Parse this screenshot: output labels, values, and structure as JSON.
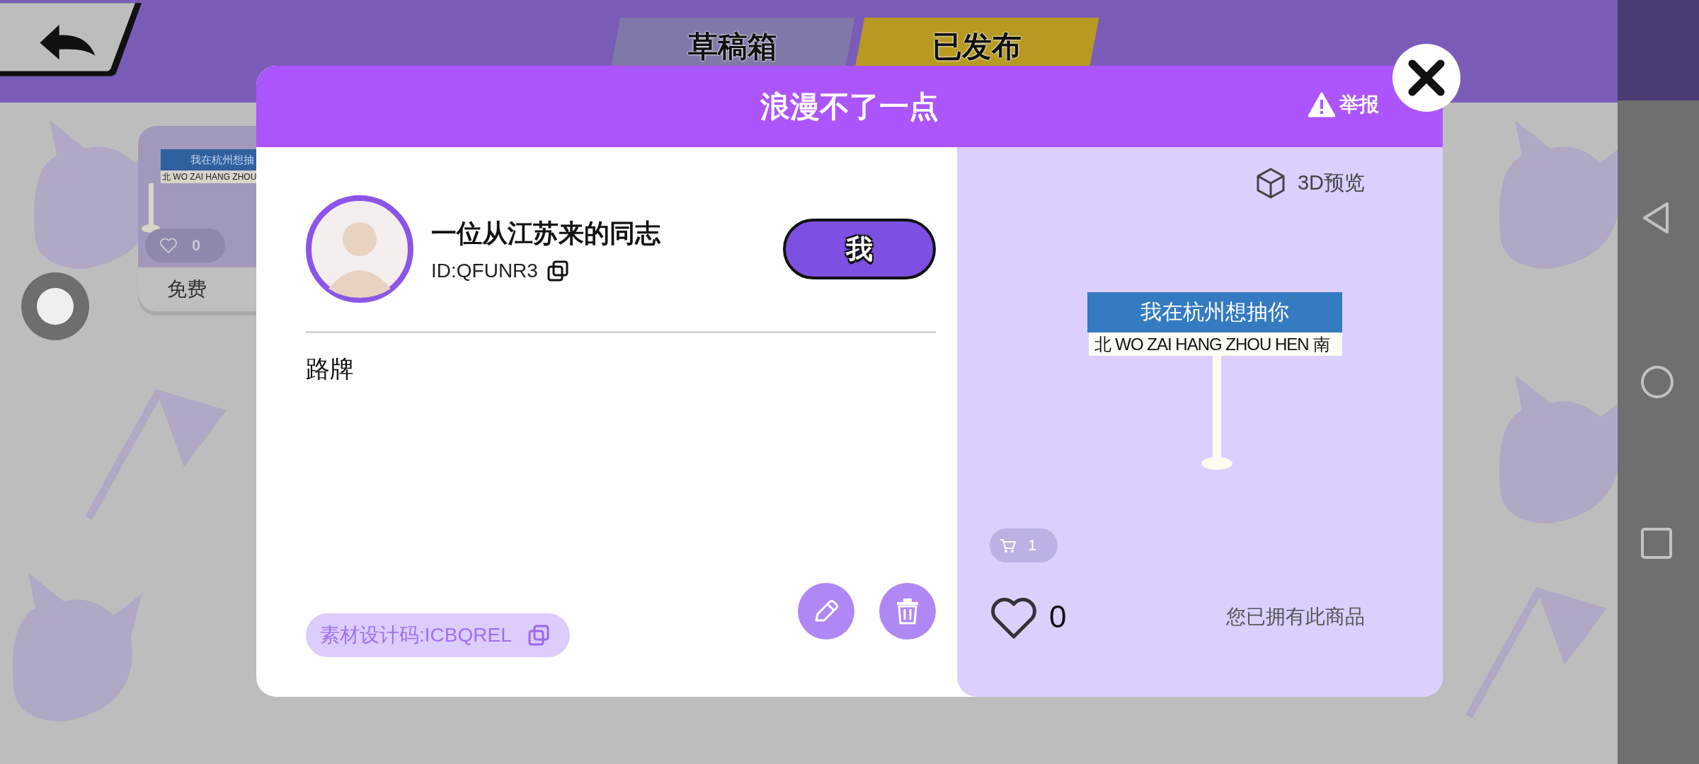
{
  "top_bar": {
    "tabs": [
      {
        "label": "草稿箱",
        "selected": false
      },
      {
        "label": "已发布",
        "selected": true
      }
    ]
  },
  "background_card": {
    "sign_title": "我在杭州想抽",
    "sign_subtitle": "北  WO ZAI HANG ZHOU",
    "likes": "0",
    "price": "免费"
  },
  "dialog": {
    "title": "浪漫不了一点",
    "report": "举报",
    "author": {
      "name": "一位从江苏来的同志",
      "id": "ID:QFUNR3",
      "relation": "我"
    },
    "description": "路牌",
    "design_code": "素材设计码:ICBQREL",
    "preview": {
      "label": "3D预览",
      "sign_title": "我在杭州想抽你",
      "sign_left": "北",
      "sign_middle": "WO ZAI HANG ZHOU HEN",
      "sign_right": "南"
    },
    "cart_count": "1",
    "likes": "0",
    "ownership": "您已拥有此商品"
  }
}
